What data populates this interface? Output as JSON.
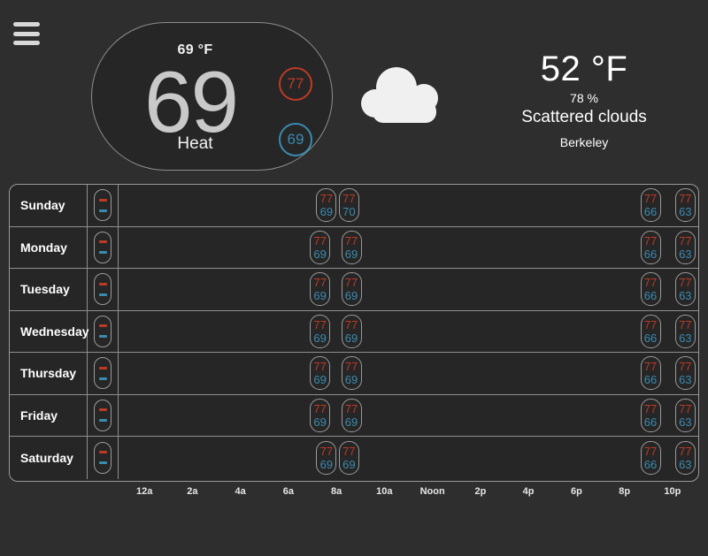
{
  "menu": {
    "icon": "hamburger-menu-icon",
    "bars": 3
  },
  "thermostat": {
    "ambient_label": "69 °F",
    "current_temperature": "69",
    "mode": "Heat",
    "heat_setpoint": "77",
    "cool_setpoint": "69",
    "heat_color": "#bf3a24",
    "cool_color": "#3a8bb0"
  },
  "weather": {
    "icon": "cloud-icon",
    "temperature": "52 °F",
    "humidity": "78 %",
    "description": "Scattered clouds",
    "location": "Berkeley"
  },
  "schedule": {
    "hours": [
      {
        "label": "12a",
        "pct": 4.17
      },
      {
        "label": "2a",
        "pct": 12.5
      },
      {
        "label": "4a",
        "pct": 20.83
      },
      {
        "label": "6a",
        "pct": 29.17
      },
      {
        "label": "8a",
        "pct": 37.5
      },
      {
        "label": "10a",
        "pct": 45.83
      },
      {
        "label": "Noon",
        "pct": 54.17
      },
      {
        "label": "2p",
        "pct": 62.5
      },
      {
        "label": "4p",
        "pct": 70.83
      },
      {
        "label": "6p",
        "pct": 79.17
      },
      {
        "label": "8p",
        "pct": 87.5
      },
      {
        "label": "10p",
        "pct": 95.83
      }
    ],
    "days": [
      {
        "name": "Sunday",
        "toggle": {
          "hot": "-",
          "cold": "-"
        },
        "setpoints": [
          {
            "hot": "77",
            "cold": "69",
            "pct": 34.1
          },
          {
            "hot": "77",
            "cold": "70",
            "pct": 38.0
          },
          {
            "hot": "77",
            "cold": "66",
            "pct": 90.0
          },
          {
            "hot": "77",
            "cold": "63",
            "pct": 96.0
          }
        ]
      },
      {
        "name": "Monday",
        "toggle": {
          "hot": "-",
          "cold": "-"
        },
        "setpoints": [
          {
            "hot": "77",
            "cold": "69",
            "pct": 33.0
          },
          {
            "hot": "77",
            "cold": "69",
            "pct": 38.4
          },
          {
            "hot": "77",
            "cold": "66",
            "pct": 90.0
          },
          {
            "hot": "77",
            "cold": "63",
            "pct": 96.0
          }
        ]
      },
      {
        "name": "Tuesday",
        "toggle": {
          "hot": "-",
          "cold": "-"
        },
        "setpoints": [
          {
            "hot": "77",
            "cold": "69",
            "pct": 33.0
          },
          {
            "hot": "77",
            "cold": "69",
            "pct": 38.4
          },
          {
            "hot": "77",
            "cold": "66",
            "pct": 90.0
          },
          {
            "hot": "77",
            "cold": "63",
            "pct": 96.0
          }
        ]
      },
      {
        "name": "Wednesday",
        "toggle": {
          "hot": "-",
          "cold": "-"
        },
        "setpoints": [
          {
            "hot": "77",
            "cold": "69",
            "pct": 33.0
          },
          {
            "hot": "77",
            "cold": "69",
            "pct": 38.4
          },
          {
            "hot": "77",
            "cold": "66",
            "pct": 90.0
          },
          {
            "hot": "77",
            "cold": "63",
            "pct": 96.0
          }
        ]
      },
      {
        "name": "Thursday",
        "toggle": {
          "hot": "-",
          "cold": "-"
        },
        "setpoints": [
          {
            "hot": "77",
            "cold": "69",
            "pct": 33.0
          },
          {
            "hot": "77",
            "cold": "69",
            "pct": 38.4
          },
          {
            "hot": "77",
            "cold": "66",
            "pct": 90.0
          },
          {
            "hot": "77",
            "cold": "63",
            "pct": 96.0
          }
        ]
      },
      {
        "name": "Friday",
        "toggle": {
          "hot": "-",
          "cold": "-"
        },
        "setpoints": [
          {
            "hot": "77",
            "cold": "69",
            "pct": 33.0
          },
          {
            "hot": "77",
            "cold": "69",
            "pct": 38.4
          },
          {
            "hot": "77",
            "cold": "66",
            "pct": 90.0
          },
          {
            "hot": "77",
            "cold": "63",
            "pct": 96.0
          }
        ]
      },
      {
        "name": "Saturday",
        "toggle": {
          "hot": "-",
          "cold": "-"
        },
        "setpoints": [
          {
            "hot": "77",
            "cold": "69",
            "pct": 34.1
          },
          {
            "hot": "77",
            "cold": "69",
            "pct": 38.0
          },
          {
            "hot": "77",
            "cold": "66",
            "pct": 90.0
          },
          {
            "hot": "77",
            "cold": "63",
            "pct": 96.0
          }
        ]
      }
    ]
  },
  "colors": {
    "background": "#2e2e2e",
    "panel": "#262626",
    "border": "#9a9a9a",
    "text": "#ffffff",
    "heat": "#bf3a24",
    "cool": "#3a8bb0",
    "dial_digits": "#c9c9c9"
  }
}
